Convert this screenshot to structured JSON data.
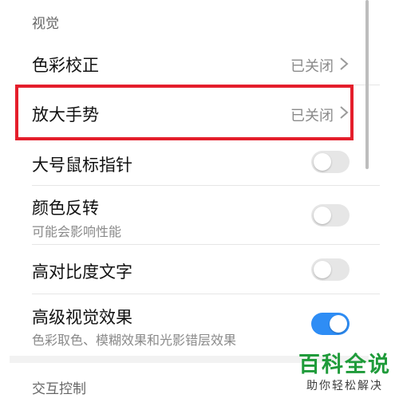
{
  "sections": {
    "vision_header": "视觉",
    "interaction_header": "交互控制"
  },
  "rows": {
    "color_correction": {
      "title": "色彩校正",
      "value": "已关闭"
    },
    "magnification": {
      "title": "放大手势",
      "value": "已关闭"
    },
    "large_pointer": {
      "title": "大号鼠标指针",
      "toggle_on": false
    },
    "color_inversion": {
      "title": "颜色反转",
      "subtitle": "可能会影响性能",
      "toggle_on": false
    },
    "high_contrast": {
      "title": "高对比度文字",
      "toggle_on": false
    },
    "advanced_visual": {
      "title": "高级视觉效果",
      "subtitle": "色彩取色、模糊效果和光影错层效果",
      "toggle_on": true
    }
  },
  "watermark": {
    "title": "百科全说",
    "subtitle": "助你轻松解决"
  },
  "colors": {
    "accent": "#2e8df5",
    "highlight_border": "#e41e2b",
    "watermark": "#1f9b3a"
  },
  "icons": {
    "chevron": "chevron-right-icon"
  }
}
